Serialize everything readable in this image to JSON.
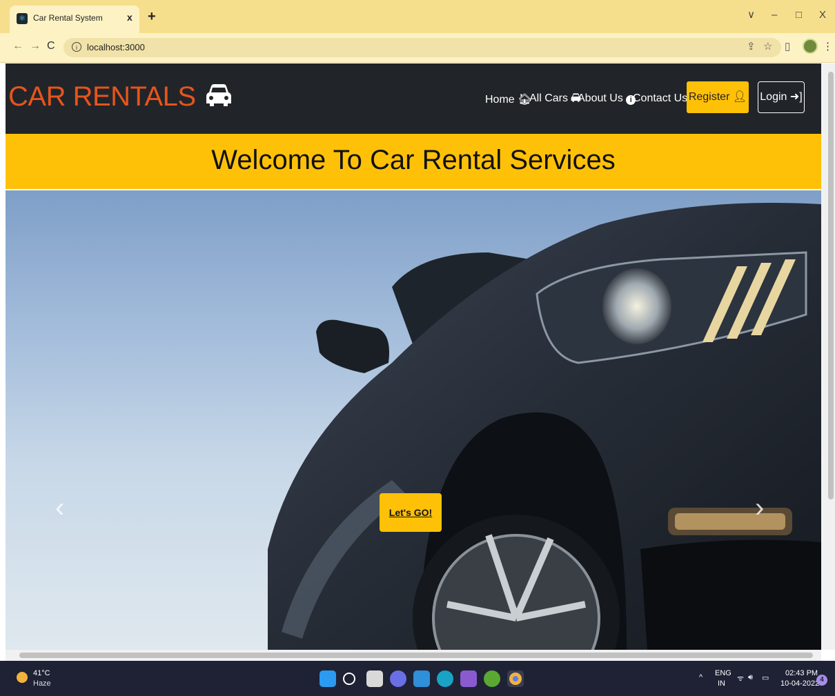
{
  "browser": {
    "tab_title": "Car Rental System",
    "tab_close": "x",
    "new_tab": "+",
    "url": "localhost:3000",
    "window_controls": {
      "minimize": "–",
      "maximize": "□",
      "close": "X",
      "dropdown": "∨"
    },
    "nav": {
      "back": "←",
      "forward": "→",
      "reload": "C"
    }
  },
  "navbar": {
    "brand": "CAR RENTALS",
    "links": [
      {
        "label": "Home"
      },
      {
        "label": "All Cars"
      },
      {
        "label": "About Us"
      },
      {
        "label": "Contact Us"
      }
    ],
    "register": "Register",
    "login": "Login"
  },
  "banner": {
    "title": "Welcome To Car Rental Services"
  },
  "hero": {
    "cta": "Let's GO!",
    "prev": "‹",
    "next": "›"
  },
  "taskbar": {
    "weather": {
      "temp": "41°C",
      "desc": "Haze"
    },
    "lang": {
      "top": "ENG",
      "bottom": "IN"
    },
    "time": "02:43 PM",
    "date": "10-04-2022",
    "notifications": "4",
    "tray_caret": "^"
  },
  "colors": {
    "accent": "#ffc107",
    "brand": "#e8541c",
    "navbar": "#212529"
  }
}
